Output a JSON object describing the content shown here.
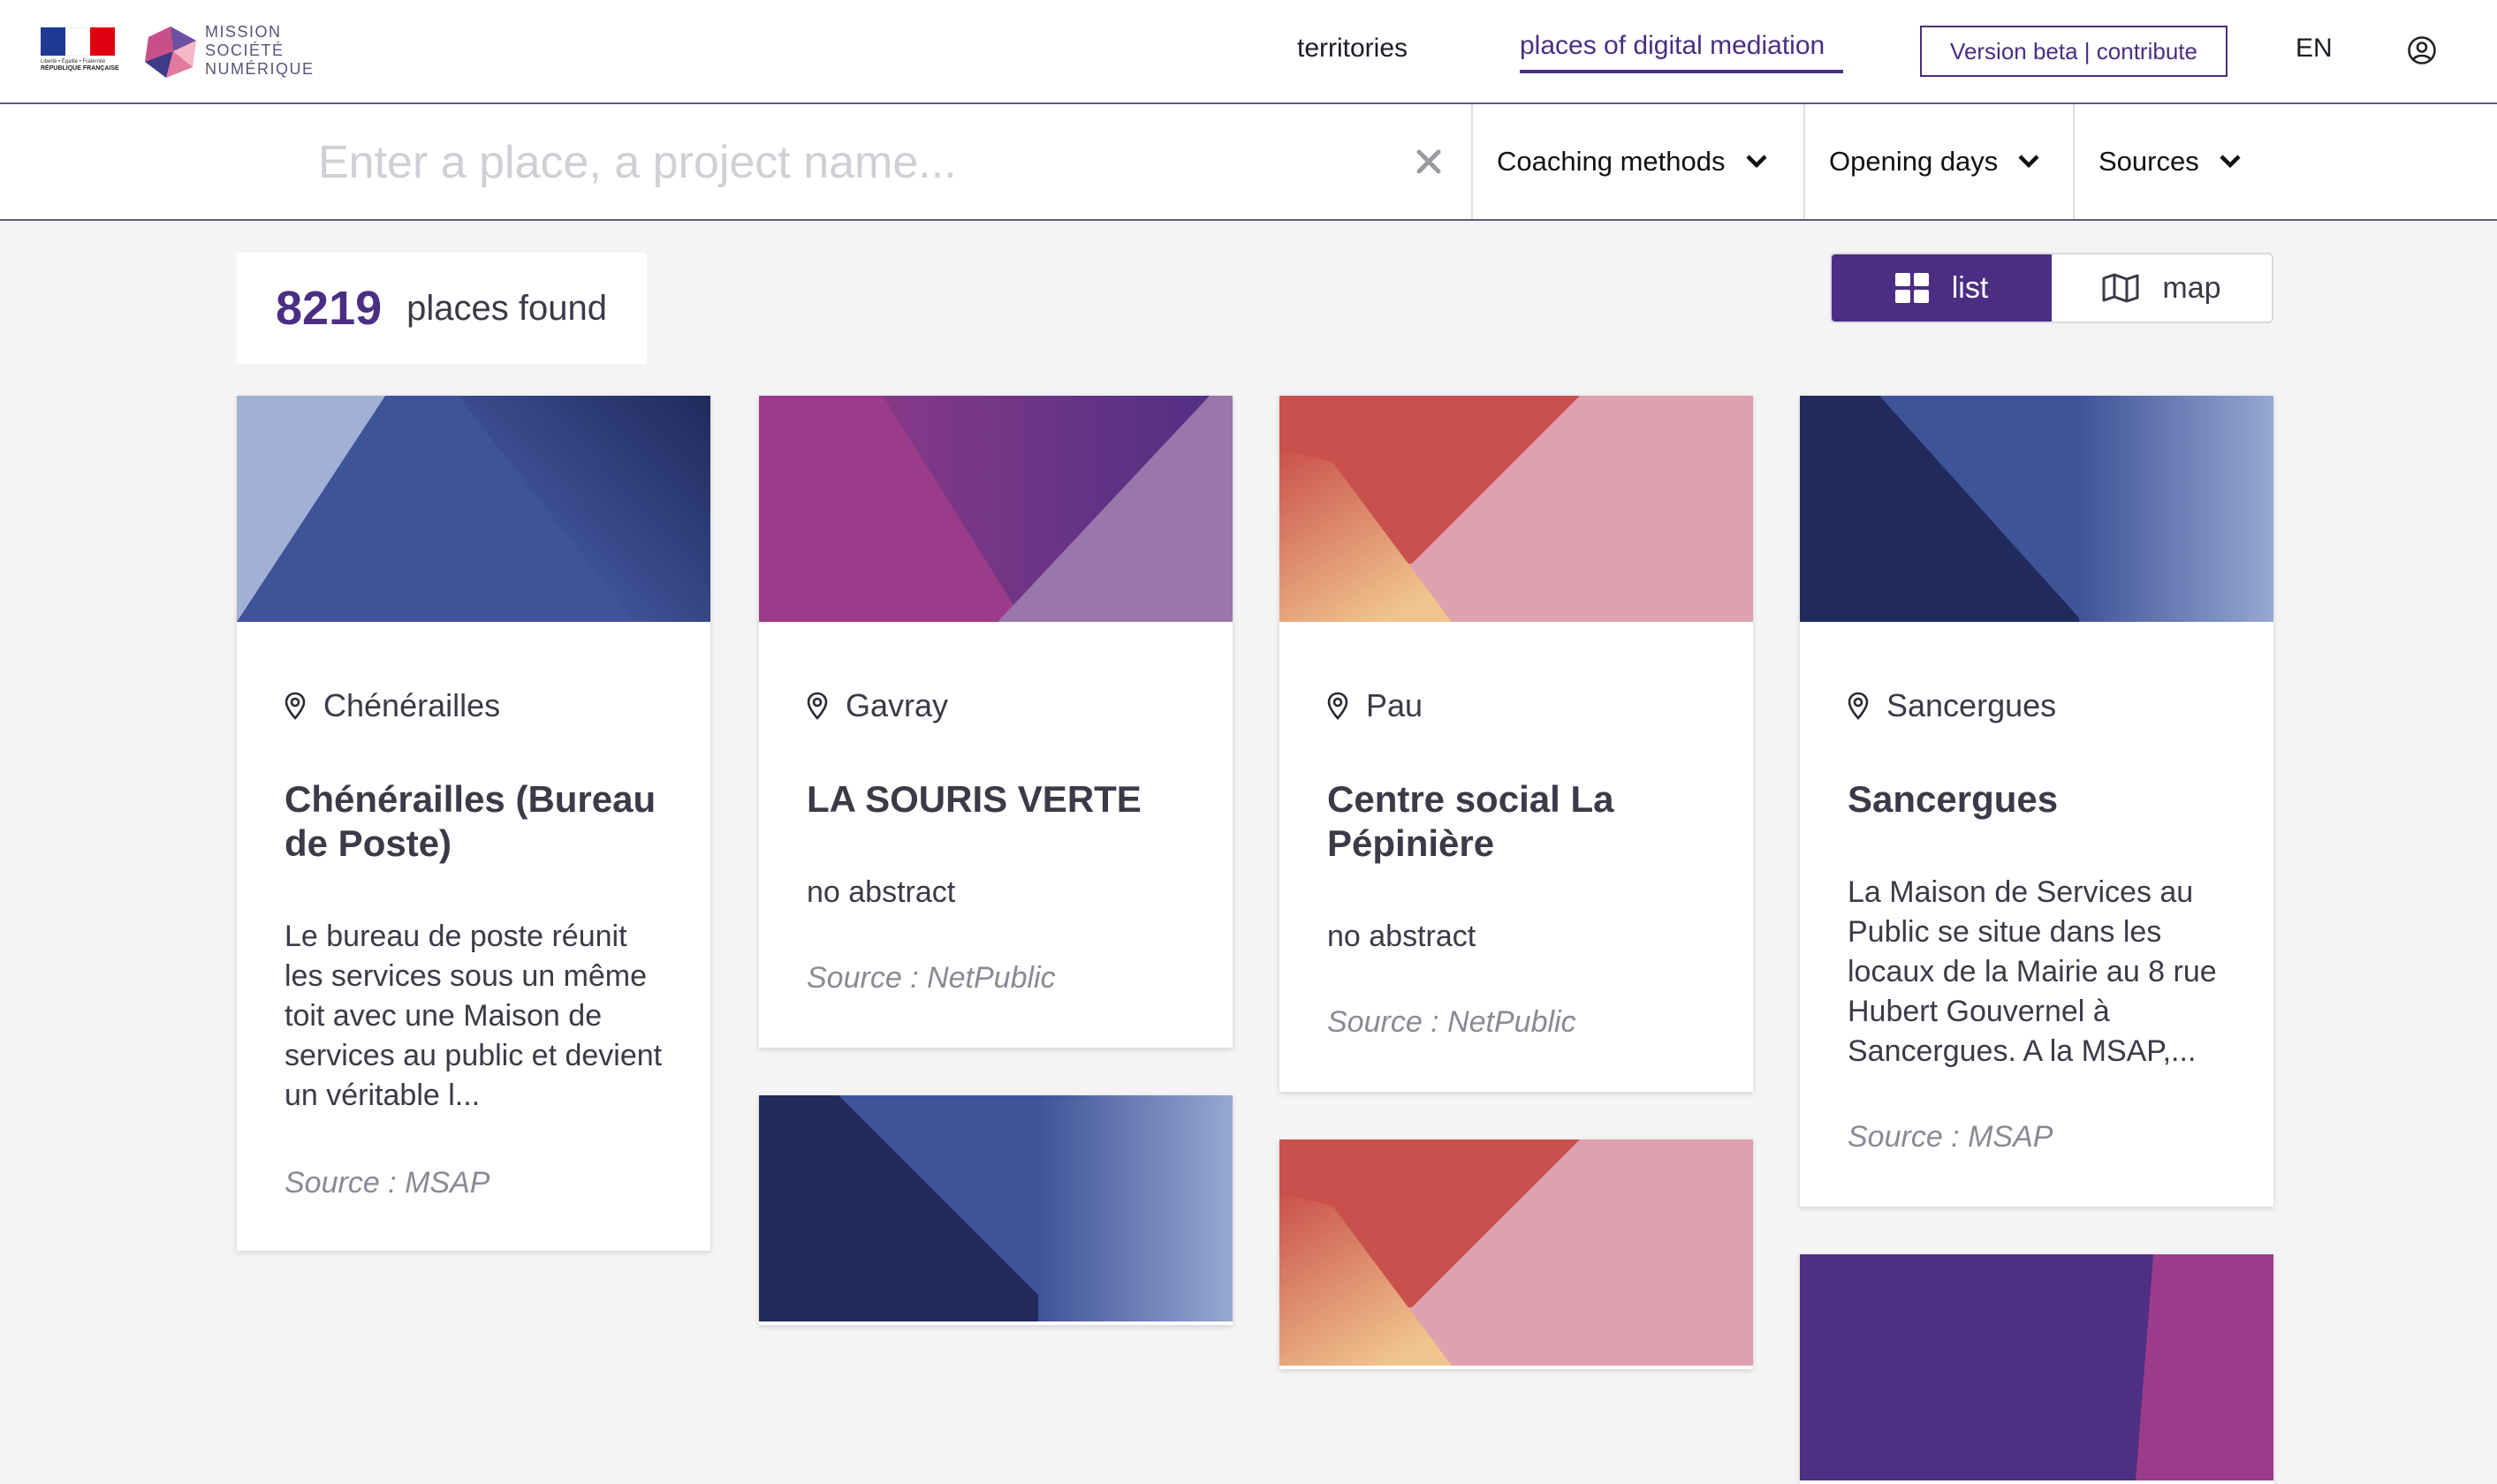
{
  "header": {
    "rf_logo": {
      "motto": "Liberté • Égalité • Fraternité",
      "name": "RÉPUBLIQUE FRANÇAISE"
    },
    "brand_lines": [
      "MISSION",
      "SOCIÉTÉ",
      "NUMÉRIQUE"
    ],
    "nav": [
      {
        "label": "territories",
        "active": false
      },
      {
        "label": "places of digital mediation",
        "active": true
      }
    ],
    "beta_label": "Version beta | contribute",
    "language": "EN",
    "user_icon": "user-circle-icon"
  },
  "search": {
    "placeholder": "Enter a place, a project name...",
    "value": "",
    "clear_icon": "close-icon",
    "filters": [
      {
        "label": "Coaching methods",
        "icon": "chevron-down-icon"
      },
      {
        "label": "Opening days",
        "icon": "chevron-down-icon"
      },
      {
        "label": "Sources",
        "icon": "chevron-down-icon"
      }
    ]
  },
  "results": {
    "count": "8219",
    "label": "places found"
  },
  "view_toggle": {
    "list_label": "list",
    "map_label": "map",
    "selected": "list"
  },
  "cards": [
    {
      "place": "Chénérailles",
      "title": "Chénérailles (Bureau de Poste)",
      "abstract": "Le bureau de poste réunit les services sous un même toit avec une Maison de services au public et devient un véritable l...",
      "source": "Source : MSAP"
    },
    {
      "place": "Gavray",
      "title": "LA SOURIS VERTE",
      "abstract": "no abstract",
      "source": "Source : NetPublic"
    },
    {
      "place": "Pau",
      "title": "Centre social La Pépinière",
      "abstract": "no abstract",
      "source": "Source : NetPublic"
    },
    {
      "place": "Sancergues",
      "title": "Sancergues",
      "abstract": "La Maison de Services au Public se situe dans les locaux de la Mairie au 8 rue Hubert Gouvernel à Sancergues. A la MSAP,...",
      "source": "Source : MSAP"
    }
  ],
  "colors": {
    "accent": "#4b2e83",
    "background": "#f4f4f4",
    "text": "#3a3a48",
    "muted": "#8a8a96"
  }
}
